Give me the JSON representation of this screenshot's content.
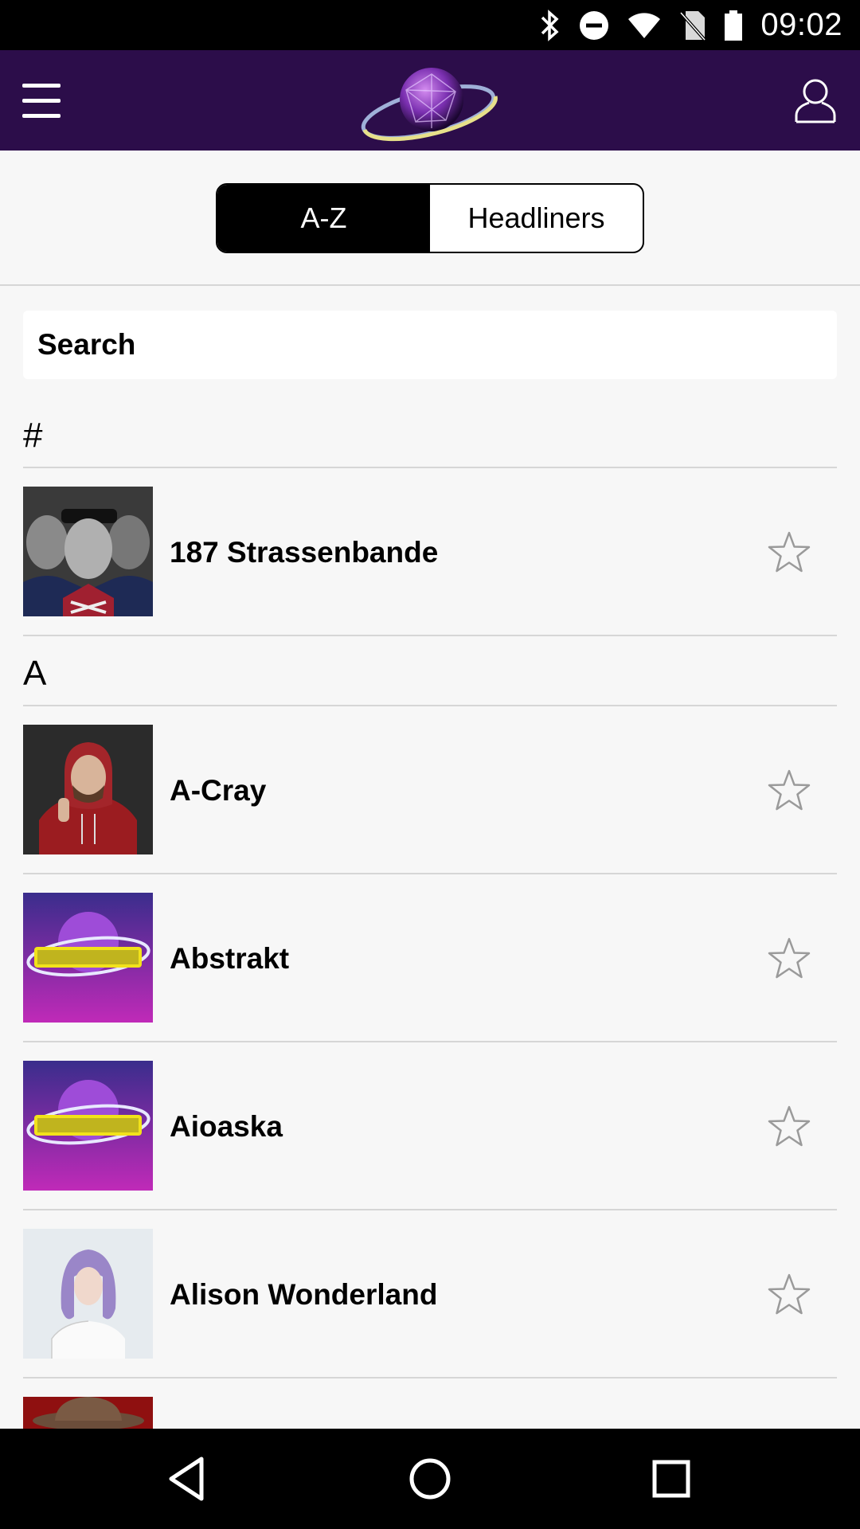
{
  "status_bar": {
    "time": "09:02",
    "icons": [
      "bluetooth-icon",
      "do-not-disturb-icon",
      "wifi-icon",
      "no-sim-icon",
      "battery-icon"
    ]
  },
  "header": {
    "menu_icon": "hamburger-menu-icon",
    "logo": "planet-logo",
    "profile_icon": "user-profile-icon",
    "background_color": "#2c0d4a"
  },
  "tabs": [
    {
      "label": "A-Z",
      "active": true
    },
    {
      "label": "Headliners",
      "active": false
    }
  ],
  "search": {
    "placeholder": "Search",
    "value": ""
  },
  "sections": [
    {
      "header": "#",
      "artists": [
        {
          "name": "187 Strassenbande",
          "thumbnail": "group-photo",
          "favorite": false
        }
      ]
    },
    {
      "header": "A",
      "artists": [
        {
          "name": "A-Cray",
          "thumbnail": "portrait-red-hoodie",
          "favorite": false
        },
        {
          "name": "Abstrakt",
          "thumbnail": "frequency-logo",
          "favorite": false
        },
        {
          "name": "Aioaska",
          "thumbnail": "frequency-logo",
          "favorite": false
        },
        {
          "name": "Alison Wonderland",
          "thumbnail": "portrait-purple-hair",
          "favorite": false
        }
      ]
    }
  ],
  "nav_bar": {
    "buttons": [
      "back-icon",
      "home-icon",
      "recents-icon"
    ]
  }
}
